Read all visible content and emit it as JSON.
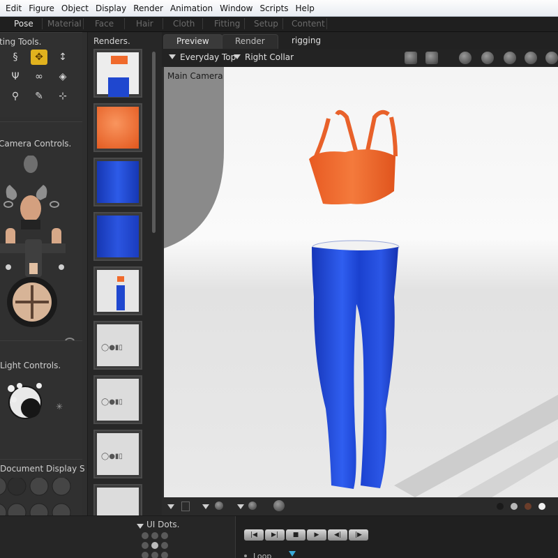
{
  "menu": [
    "Edit",
    "Figure",
    "Object",
    "Display",
    "Render",
    "Animation",
    "Window",
    "Scripts",
    "Help"
  ],
  "rooms": [
    "Pose",
    "Material",
    "Face",
    "Hair",
    "Cloth",
    "Fitting",
    "Setup",
    "Content"
  ],
  "active_room": "Pose",
  "left_panel": {
    "editing_tools_title": "ting Tools.",
    "camera_controls_title": "Camera Controls.",
    "light_controls_title": "Light Controls.",
    "document_display_title": "Document Display S"
  },
  "renders": {
    "title": "Renders.",
    "thumbnails": [
      "full-outfit",
      "orange-top-closeup",
      "blue-jeans-top",
      "blue-jeans-leg",
      "full-outfit-small",
      "empty",
      "empty",
      "empty",
      "empty"
    ]
  },
  "viewport": {
    "tabs": [
      "Preview",
      "Render",
      "rigging"
    ],
    "active_tab": "Preview",
    "figure_select": "Everyday Top",
    "actor_select": "Right Collar",
    "camera_label": "Main Camera"
  },
  "bottom": {
    "ui_dots_label": "UI Dots.",
    "loop_label": "Loop"
  },
  "colors": {
    "top": "#f06a2c",
    "jeans": "#1f47cf",
    "active_tool": "#e1b21e"
  }
}
